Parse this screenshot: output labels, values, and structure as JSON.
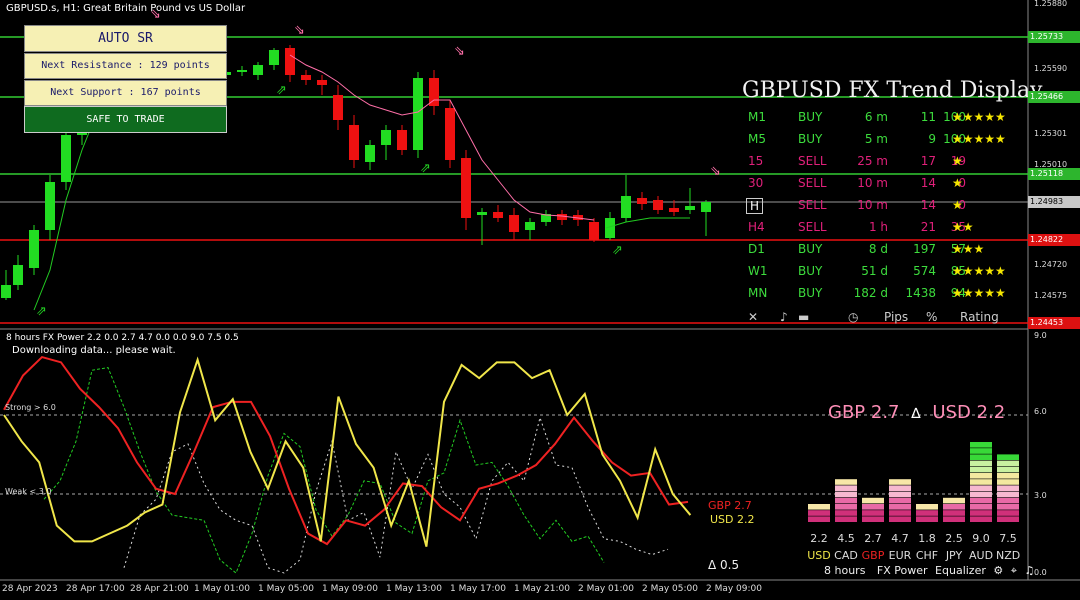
{
  "header": {
    "symbol_line": "GBPUSD.s, H1:  Great Britain Pound vs US Dollar",
    "indicator_line": "8 hours FX Power 2.2 0.0 2.7 4.7 0.0 0.0 9.0 7.5 0.5",
    "downloading": "Downloading data... please wait."
  },
  "auto_sr": {
    "title": "AUTO SR",
    "resistance": "Next Resistance : 129 points",
    "support": "Next Support : 167 points",
    "safe": "SAFE TO TRADE"
  },
  "trend": {
    "title": "GBPUSD FX Trend Display",
    "rows": [
      {
        "tf": "M1",
        "dir": "BUY",
        "dur": "6 m",
        "pips": "11",
        "pct": "100",
        "stars": "★★★★★",
        "color": "#3ddc3d"
      },
      {
        "tf": "M5",
        "dir": "BUY",
        "dur": "5 m",
        "pips": "9",
        "pct": "100",
        "stars": "★★★★★",
        "color": "#3ddc3d"
      },
      {
        "tf": "15",
        "dir": "SELL",
        "dur": "25 m",
        "pips": "17",
        "pct": "19",
        "stars": "★",
        "color": "#e0207a"
      },
      {
        "tf": "30",
        "dir": "SELL",
        "dur": "10 m",
        "pips": "14",
        "pct": "0",
        "stars": "★",
        "color": "#e0207a"
      },
      {
        "tf": "H",
        "dir": "SELL",
        "dur": "10 m",
        "pips": "14",
        "pct": "0",
        "stars": "★",
        "color": "#e0207a"
      },
      {
        "tf": "H4",
        "dir": "SELL",
        "dur": "1 h",
        "pips": "21",
        "pct": "35",
        "stars": "★★",
        "color": "#e0207a"
      },
      {
        "tf": "D1",
        "dir": "BUY",
        "dur": "8 d",
        "pips": "197",
        "pct": "57",
        "stars": "★★★",
        "color": "#3ddc3d"
      },
      {
        "tf": "W1",
        "dir": "BUY",
        "dur": "51 d",
        "pips": "574",
        "pct": "85",
        "stars": "★★★★★",
        "color": "#3ddc3d"
      },
      {
        "tf": "MN",
        "dir": "BUY",
        "dur": "182 d",
        "pips": "1438",
        "pct": "94",
        "stars": "★★★★★",
        "color": "#3ddc3d"
      }
    ],
    "footer": {
      "close": "✕",
      "pips": "Pips",
      "pct": "%",
      "rating": "Rating"
    }
  },
  "price_axis": {
    "ticks": [
      "1.25880",
      "1.25590",
      "1.25301",
      "1.25010",
      "1.24720",
      "1.24575"
    ],
    "tags": [
      {
        "text": "1.25733",
        "kind": "green"
      },
      {
        "text": "1.25466",
        "kind": "green"
      },
      {
        "text": "1.25118",
        "kind": "green"
      },
      {
        "text": "1.24983",
        "kind": "gray"
      },
      {
        "text": "1.24822",
        "kind": "red"
      },
      {
        "text": "1.24453",
        "kind": "red"
      }
    ]
  },
  "power_axis": {
    "ticks": [
      "9.0",
      "6.0",
      "3.0",
      "0.0"
    ],
    "strong": "Strong > 6.0",
    "weak": "Weak < 3.0"
  },
  "power_labels": {
    "gbp": "GBP 2.7",
    "usd": "USD 2.2",
    "delta": "Δ 0.5",
    "headline_gbp": "GBP 2.7",
    "headline_delta": "∆",
    "headline_usd": "USD 2.2"
  },
  "equalizer": {
    "values": [
      "2.2",
      "4.5",
      "2.7",
      "4.7",
      "1.8",
      "2.5",
      "9.0",
      "7.5"
    ],
    "currencies": [
      "USD",
      "CAD",
      "GBP",
      "EUR",
      "CHF",
      "JPY",
      "AUD",
      "NZD"
    ],
    "levels": [
      2.2,
      4.5,
      2.7,
      4.7,
      1.8,
      2.5,
      9.0,
      7.5
    ],
    "footer": {
      "period": "8 hours",
      "name": "FX Power",
      "mode": "Equalizer"
    }
  },
  "time_axis": [
    "28 Apr 2023",
    "28 Apr 17:00",
    "28 Apr 21:00",
    "1 May 01:00",
    "1 May 05:00",
    "1 May 09:00",
    "1 May 13:00",
    "1 May 17:00",
    "1 May 21:00",
    "2 May 01:00",
    "2 May 05:00",
    "2 May 09:00"
  ],
  "colors": {
    "bull": "#22dd22",
    "bear": "#ee1111",
    "support": "#ee1111",
    "resistance": "#33cc33",
    "gbp": "#ee2222",
    "usd": "#f0e64a",
    "pink": "#ff8fb8",
    "buy": "#3ddc3d",
    "sell": "#e0207a",
    "star": "#f5e600"
  }
}
